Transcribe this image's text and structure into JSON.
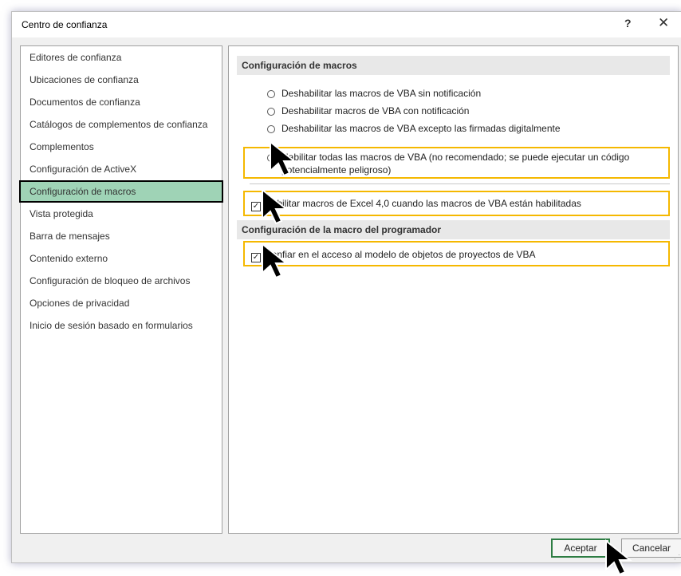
{
  "window": {
    "title": "Centro de confianza",
    "help_label": "?",
    "close_label": "✕"
  },
  "sidebar": {
    "items": [
      {
        "label": "Editores de confianza"
      },
      {
        "label": "Ubicaciones de confianza"
      },
      {
        "label": "Documentos de confianza"
      },
      {
        "label": "Catálogos de complementos de confianza"
      },
      {
        "label": "Complementos"
      },
      {
        "label": "Configuración de ActiveX"
      },
      {
        "label": "Configuración de macros",
        "selected": true
      },
      {
        "label": "Vista protegida"
      },
      {
        "label": "Barra de mensajes"
      },
      {
        "label": "Contenido externo"
      },
      {
        "label": "Configuración de bloqueo de archivos"
      },
      {
        "label": "Opciones de privacidad"
      },
      {
        "label": "Inicio de sesión basado en formularios"
      }
    ]
  },
  "macro_settings": {
    "header": "Configuración de macros",
    "options": [
      {
        "label": "Deshabilitar las macros de VBA sin notificación",
        "selected": false
      },
      {
        "label": "Deshabilitar macros de VBA con notificación",
        "selected": false
      },
      {
        "label": "Deshabilitar las macros de VBA excepto las firmadas digitalmente",
        "selected": false
      },
      {
        "label_line1": "Habilitar todas las macros de VBA (no recomendado; se puede ejecutar un código",
        "label_line2": "potencialmente peligroso)",
        "selected": true
      }
    ],
    "excel4_checkbox": {
      "label": "Habilitar macros de Excel 4,0 cuando las macros de VBA están habilitadas",
      "checked": true
    }
  },
  "developer_settings": {
    "header": "Configuración de la macro del programador",
    "trust_vba_checkbox": {
      "label": "Confiar en el acceso al modelo de objetos de proyectos de VBA",
      "checked": true
    }
  },
  "footer": {
    "ok_label": "Aceptar",
    "cancel_label": "Cancelar"
  },
  "colors": {
    "selected_nav_bg": "#9fd3b6",
    "highlight_border": "#f5b800",
    "ok_border": "#2e7d44"
  },
  "icons": [
    "mouse-pointer-icon",
    "help-icon",
    "close-icon"
  ]
}
